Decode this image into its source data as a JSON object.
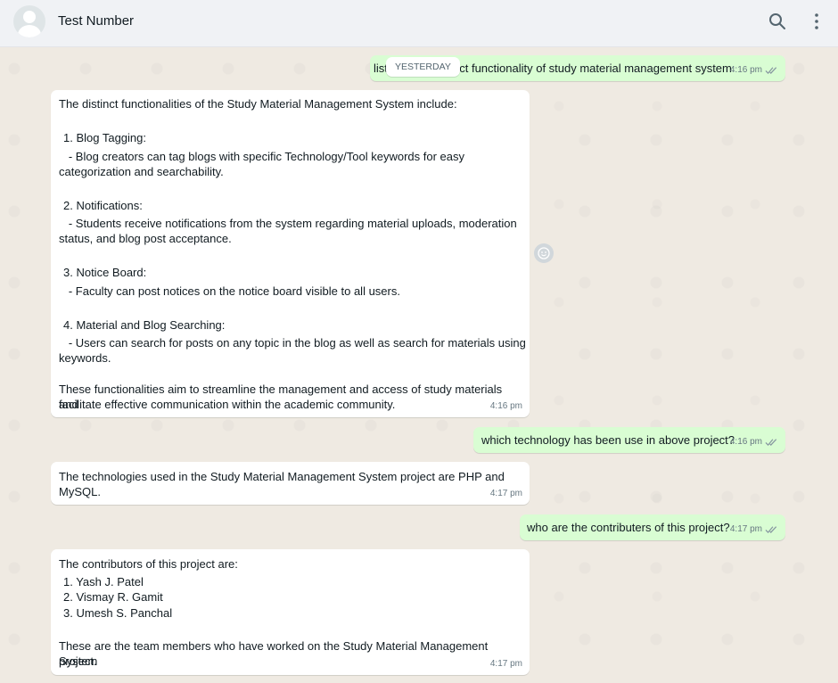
{
  "header": {
    "contact_name": "Test Number",
    "search_icon": "search-icon",
    "menu_icon": "kebab-menu-icon"
  },
  "chat": {
    "date_divider": "YESTERDAY",
    "messages": [
      {
        "direction": "outgoing",
        "text": "list distinct functionality of study material management system",
        "visible_start": "list",
        "visible_end": "nct functionality of study material management system",
        "time": "4:16 pm",
        "status": "read"
      },
      {
        "direction": "incoming",
        "intro": "The distinct functionalities of the Study Material Management System include:",
        "items": [
          {
            "title": "1. Blog Tagging:",
            "desc1": "   - Blog creators can tag blogs with specific Technology/Tool keywords for easy",
            "desc2": "categorization and searchability."
          },
          {
            "title": "2. Notifications:",
            "desc1": "   - Students receive notifications from the system regarding material uploads, moderation",
            "desc2": "status, and blog post acceptance."
          },
          {
            "title": "3. Notice Board:",
            "desc1": "   - Faculty can post notices on the notice board visible to all users.",
            "desc2": ""
          },
          {
            "title": "4. Material and Blog Searching:",
            "desc1": "   - Users can search for posts on any topic in the blog as well as search for materials using",
            "desc2": "keywords."
          }
        ],
        "outro1": "These functionalities aim to streamline the management and access of study materials and",
        "outro2": "facilitate effective communication within the academic community.",
        "time": "4:16 pm"
      },
      {
        "direction": "outgoing",
        "text": "which technology has been use in above project?",
        "time": "4:16 pm",
        "status": "read"
      },
      {
        "direction": "incoming",
        "line1": "The technologies used in the Study Material Management System project are PHP and",
        "line2": "MySQL.",
        "time": "4:17 pm"
      },
      {
        "direction": "outgoing",
        "text": "who are the contributers of this project?",
        "time": "4:17 pm",
        "status": "read"
      },
      {
        "direction": "incoming",
        "intro": "The contributors of this project are:",
        "items": [
          "1. Yash J. Patel",
          "2. Vismay R. Gamit",
          "3. Umesh S. Panchal"
        ],
        "outro1": "These are the team members who have worked on the Study Material Management System",
        "outro2": "project.",
        "time": "4:17 pm"
      }
    ]
  },
  "colors": {
    "outgoing_bubble": "#d9fdd3",
    "incoming_bubble": "#ffffff",
    "chat_background": "#efeae2",
    "header_background": "#f0f2f5"
  }
}
